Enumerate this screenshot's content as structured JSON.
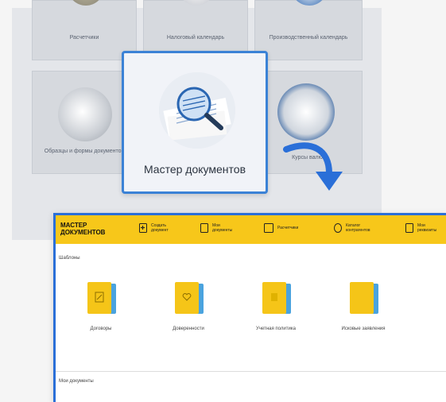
{
  "background_tiles": {
    "row1": [
      "Расчетчики",
      "Налоговый календарь",
      "Производственный календарь"
    ],
    "row2_left": "Образцы и формы документов",
    "row2_right": "Курсы валют"
  },
  "focus_tile": {
    "label": "Мастер документов"
  },
  "app": {
    "brand": "МАСТЕР ДОКУМЕНТОВ",
    "nav": [
      {
        "label": "Создать документ",
        "icon": "plus-doc-icon"
      },
      {
        "label": "Мои документы",
        "icon": "docs-icon"
      },
      {
        "label": "Расчетчики",
        "icon": "calc-icon"
      },
      {
        "label": "Каталог контрагентов",
        "icon": "contacts-icon"
      },
      {
        "label": "Мои реквизиты",
        "icon": "requisites-icon"
      }
    ],
    "templates_title": "Шаблоны",
    "templates": [
      {
        "label": "Договоры",
        "icon": "edit-icon"
      },
      {
        "label": "Доверенности",
        "icon": "heart-icon"
      },
      {
        "label": "Учетная политика",
        "icon": "doc-icon"
      },
      {
        "label": "Исковые заявления",
        "icon": "blank-icon"
      }
    ],
    "my_docs_title": "Мои документы"
  },
  "colors": {
    "accent": "#2a6fd8",
    "header": "#f7c71a",
    "folder": "#f5c518",
    "folder_back": "#4aa3df"
  }
}
